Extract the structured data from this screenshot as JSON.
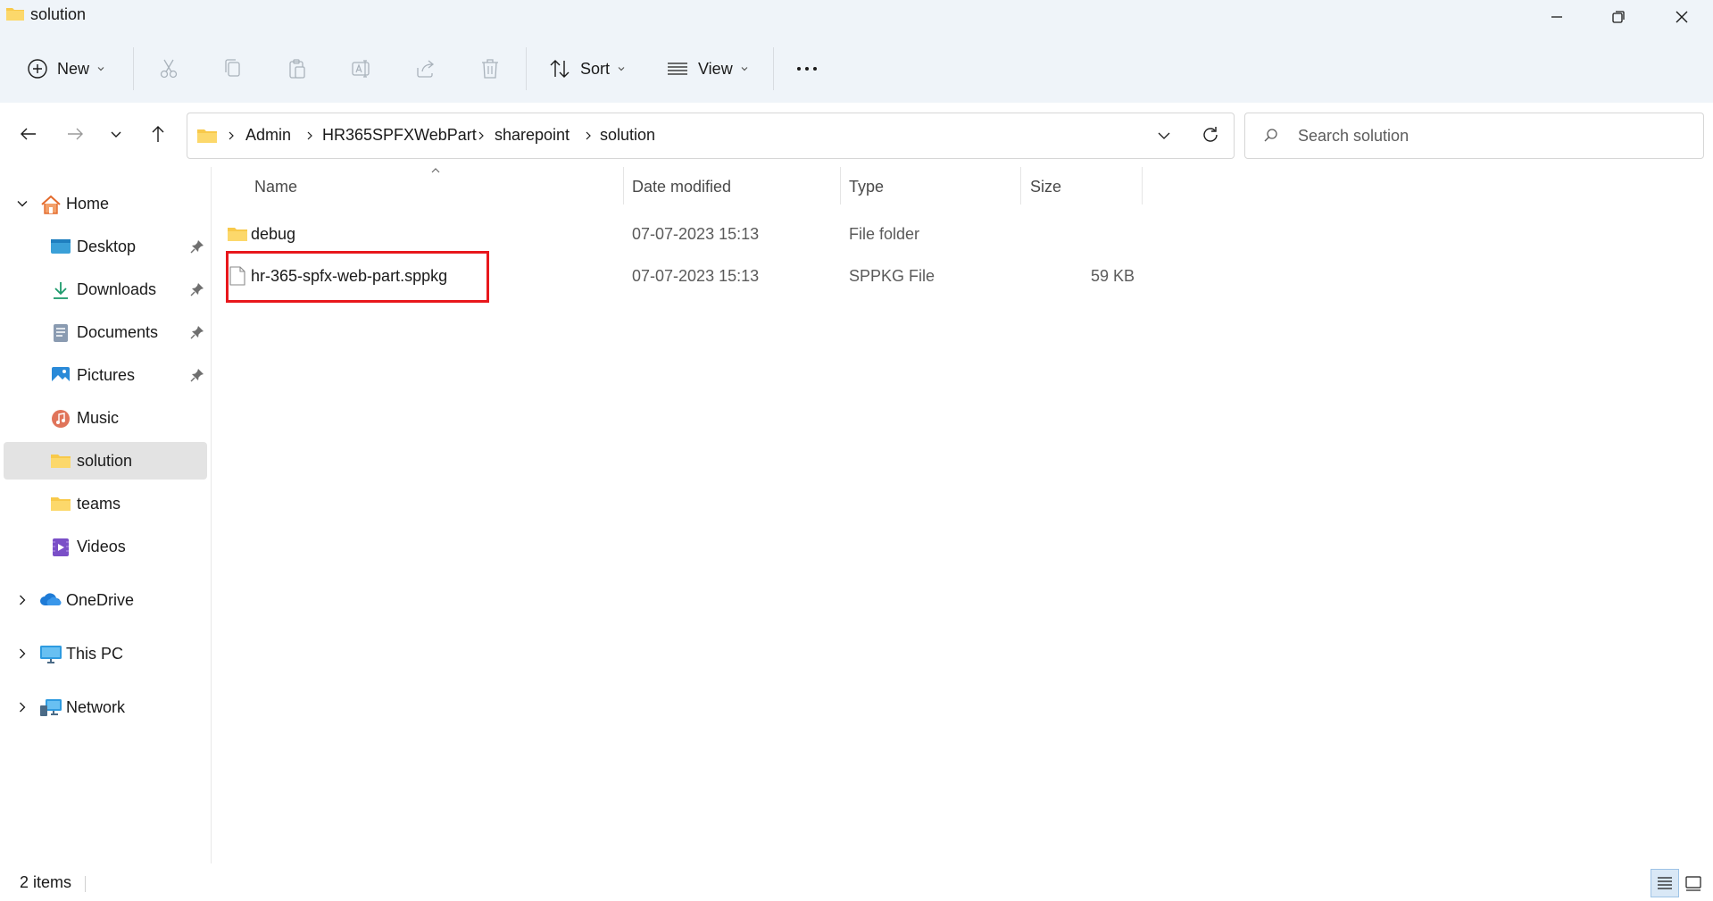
{
  "window": {
    "title": "solution"
  },
  "toolbar": {
    "new_label": "New",
    "sort_label": "Sort",
    "view_label": "View"
  },
  "address": {
    "crumbs": [
      "Admin",
      "HR365SPFXWebPart",
      "sharepoint",
      "solution"
    ],
    "search_placeholder": "Search solution"
  },
  "sidebar": {
    "items": [
      {
        "label": "Home",
        "icon": "home-icon"
      },
      {
        "label": "Desktop",
        "icon": "desktop-icon",
        "pinned": true
      },
      {
        "label": "Downloads",
        "icon": "downloads-icon",
        "pinned": true
      },
      {
        "label": "Documents",
        "icon": "documents-icon",
        "pinned": true
      },
      {
        "label": "Pictures",
        "icon": "pictures-icon",
        "pinned": true
      },
      {
        "label": "Music",
        "icon": "music-icon"
      },
      {
        "label": "solution",
        "icon": "folder-icon",
        "selected": true
      },
      {
        "label": "teams",
        "icon": "folder-icon"
      },
      {
        "label": "Videos",
        "icon": "videos-icon"
      },
      {
        "label": "OneDrive",
        "icon": "onedrive-icon"
      },
      {
        "label": "This PC",
        "icon": "this-pc-icon"
      },
      {
        "label": "Network",
        "icon": "network-icon"
      }
    ]
  },
  "file_list": {
    "columns": [
      "Name",
      "Date modified",
      "Type",
      "Size"
    ],
    "sorted_column": "Name",
    "rows": [
      {
        "name": "debug",
        "date": "07-07-2023 15:13",
        "type": "File folder",
        "size": "",
        "icon": "folder-icon"
      },
      {
        "name": "hr-365-spfx-web-part.sppkg",
        "date": "07-07-2023 15:13",
        "type": "SPPKG File",
        "size": "59 KB",
        "icon": "file-icon",
        "highlighted": true
      }
    ]
  },
  "status": {
    "item_count": "2 items"
  },
  "colors": {
    "folder": "#f8c94a",
    "highlight_border": "#e8171c",
    "selection": "#e3e3e3",
    "chrome": "#eff4f9"
  }
}
